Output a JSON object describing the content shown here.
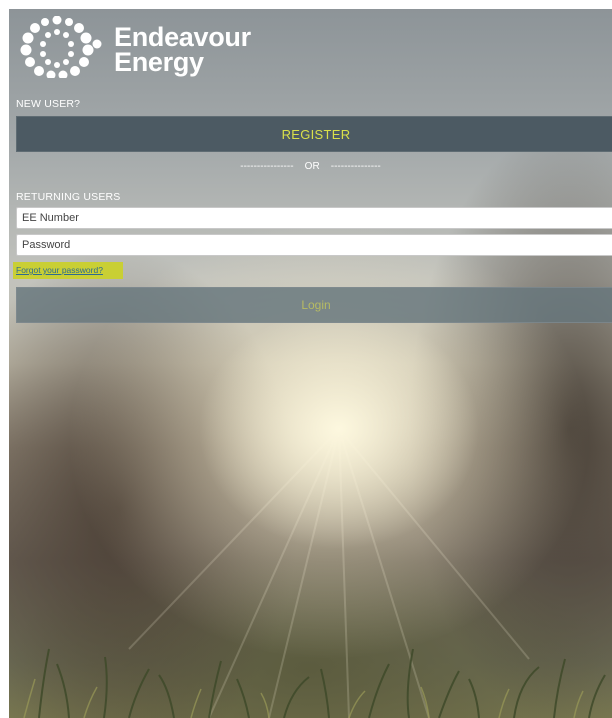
{
  "brand": {
    "name_line1": "Endeavour",
    "name_line2": "Energy",
    "logo_icon": "endeavour-energy-dots-logo-icon"
  },
  "new_user": {
    "label": "NEW USER?",
    "register_label": "REGISTER"
  },
  "divider": {
    "text": "----------------    OR    ---------------"
  },
  "returning": {
    "label": "RETURNING USERS",
    "ee_number_placeholder": "EE Number",
    "password_placeholder": "Password",
    "forgot_link": "Forgot your password?",
    "login_label": "Login"
  },
  "colors": {
    "register_bg": "#4c5a63",
    "accent_yellow": "#d9e04a",
    "forgot_highlight": "#c9cf34",
    "link_blue": "#2e6b8f"
  }
}
